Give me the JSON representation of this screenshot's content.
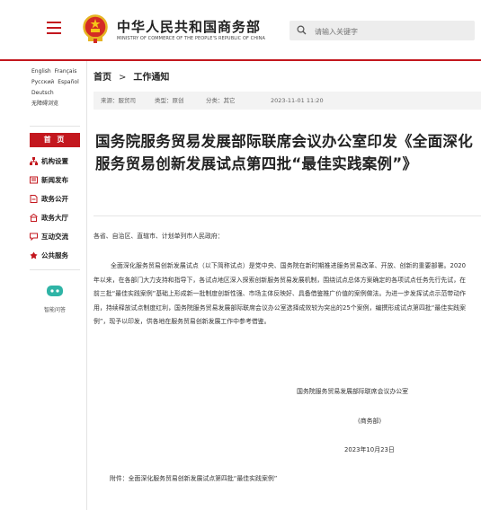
{
  "header": {
    "site_title": "中华人民共和国商务部",
    "site_subtitle": "MINISTRY OF COMMERCE OF THE PEOPLE'S REPUBLIC OF CHINA",
    "search_placeholder": "请输入关键字"
  },
  "sidebar": {
    "languages": [
      "English",
      "Français",
      "Русский",
      "Español",
      "Deutsch"
    ],
    "accessibility": "无障碍浏览",
    "home": "首 页",
    "items": [
      {
        "label": "机构设置",
        "icon": "org-icon"
      },
      {
        "label": "新闻发布",
        "icon": "news-icon"
      },
      {
        "label": "政务公开",
        "icon": "document-icon"
      },
      {
        "label": "政务大厅",
        "icon": "hall-icon"
      },
      {
        "label": "互动交流",
        "icon": "chat-icon"
      },
      {
        "label": "公共服务",
        "icon": "service-icon"
      }
    ],
    "assistant": "智能问答"
  },
  "breadcrumb": [
    "首页",
    "工作通知"
  ],
  "meta": {
    "source": "来源：服贸司",
    "type": "类型：原创",
    "category": "分类：其它",
    "datetime": "2023-11-01 11:20"
  },
  "article": {
    "title": "国务院服务贸易发展部际联席会议办公室印发《全面深化服务贸易创新发展试点第四批“最佳实践案例”》",
    "salutation": "各省、自治区、直辖市、计划单列市人民政府：",
    "paragraph": "全面深化服务贸易创新发展试点（以下简称试点）是党中央、国务院在新时期推进服务贸易改革、开放、创新的重要部署。2020年以来，在各部门大力支持和指导下，各试点地区深入探索创新服务贸易发展机制，围绕试点总体方案确定的各项试点任务先行先试，在前三批“最佳实践案例”基础上形成新一批制度创新性强、市场主体反映好、具备借鉴推广价值的案例做法。为进一步发挥试点示范带动作用，持续释放试点制度红利，国务院服务贸易发展部际联席会议办公室选择成效较为突出的25个案例，编撰形成试点第四批“最佳实践案例”，现予以印发，供各地在服务贸易创新发展工作中参考借鉴。",
    "signature": "国务院服务贸易发展部际联席会议办公室",
    "signature_org": "(商务部)",
    "date": "2023年10月23日",
    "attachment": "附件：全面深化服务贸易创新发展试点第四批“最佳实践案例”"
  },
  "colors": {
    "brand_red": "#c3171e",
    "text": "#222222",
    "meta_bg": "#f3f3f3"
  }
}
